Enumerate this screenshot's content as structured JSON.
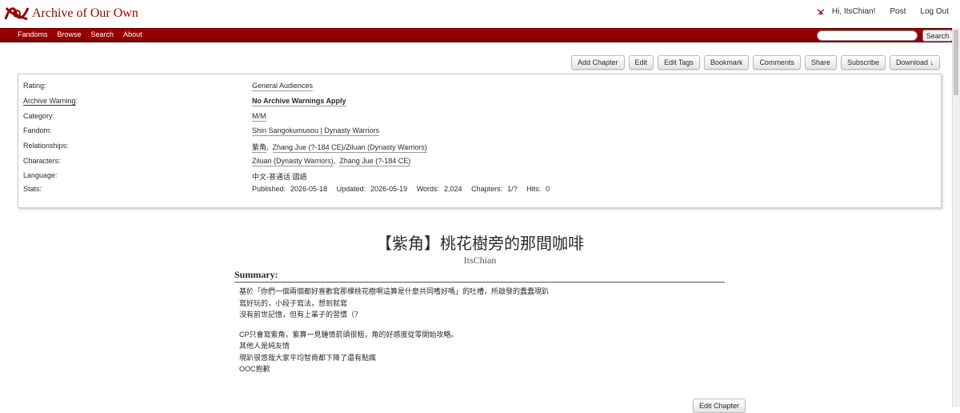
{
  "header": {
    "site_title": "Archive of Our Own",
    "greeting": "Hi, ItsChian!",
    "post": "Post",
    "logout": "Log Out"
  },
  "nav": {
    "items": [
      "Fandoms",
      "Browse",
      "Search",
      "About"
    ],
    "search_button": "Search",
    "search_value": ""
  },
  "actions": [
    "Add Chapter",
    "Edit",
    "Edit Tags",
    "Bookmark",
    "Comments",
    "Share",
    "Subscribe",
    "Download ↓"
  ],
  "meta": {
    "rating_label": "Rating:",
    "rating": "General Audiences",
    "warning_label": "Archive Warning",
    "warning_colon": ":",
    "warning": "No Archive Warnings Apply",
    "category_label": "Category:",
    "category": "M/M",
    "fandom_label": "Fandom:",
    "fandom": "Shin Sangokumusou | Dynasty Warriors",
    "relationships_label": "Relationships:",
    "relationships": [
      "紫角",
      "Zhang Jue (?-184 CE)/Ziluan (Dynasty Warriors)"
    ],
    "characters_label": "Characters:",
    "characters": [
      "Ziluan (Dynasty Warriors)",
      "Zhang Jue (?-184 CE)"
    ],
    "language_label": "Language:",
    "language": "中文-普通话 國語",
    "stats_label": "Stats:",
    "stats": {
      "published_label": "Published:",
      "published": "2026-05-18",
      "updated_label": "Updated:",
      "updated": "2026-05-19",
      "words_label": "Words:",
      "words": "2,024",
      "chapters_label": "Chapters:",
      "chapters": "1/?",
      "hits_label": "Hits:",
      "hits": "0"
    }
  },
  "work": {
    "title": "【紫角】桃花樹旁的那間咖啡",
    "author": "ItsChian",
    "summary_heading": "Summary:",
    "summary_lines": [
      "基於「你們一個兩個都好喜歡寫那棵桃花樹啊這算是什麼共同嗜好嗎」的吐槽，所啟發的蠢蠢現趴",
      "寫好玩的，小段子寫法，想到就寫",
      "沒有前世記憶，但有上輩子的習慣（？"
    ],
    "summary_lines_2": [
      "CP只會寫紫角，紫算一見鍾情箭頭很粗，角的好感度從零開始攻略。",
      "其他人是純友情",
      "現趴很悠哉大家平均智商都下降了還有點瘋",
      "OOC抱歉"
    ],
    "edit_chapter": "Edit Chapter"
  },
  "colors": {
    "brand_red": "#990000",
    "nav_red": "#9a0000"
  }
}
